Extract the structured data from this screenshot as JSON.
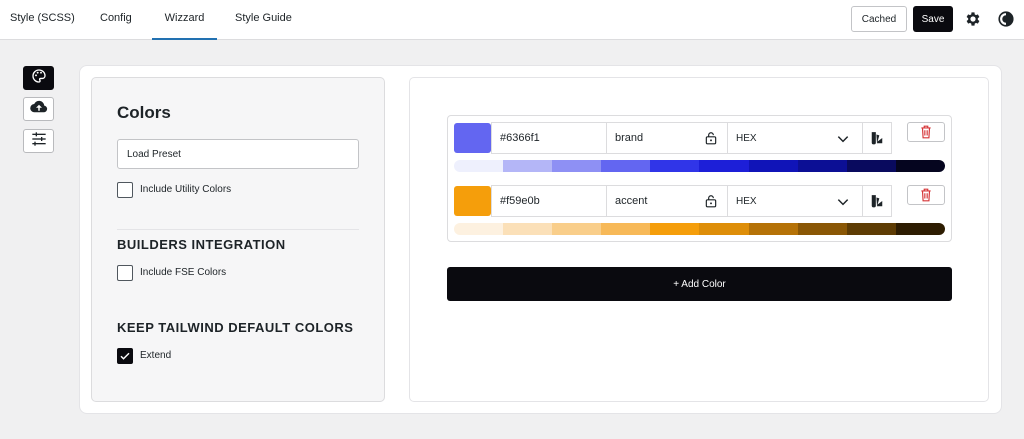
{
  "nav": {
    "tabs": [
      {
        "label": "Style (SCSS)"
      },
      {
        "label": "Config"
      },
      {
        "label": "Wizzard"
      },
      {
        "label": "Style Guide"
      }
    ],
    "active_tab": "Wizzard",
    "cached_label": "Cached",
    "save_label": "Save",
    "accent": "#2271b1",
    "icons": [
      "gear-icon",
      "contrast-icon"
    ]
  },
  "rail": {
    "items": [
      {
        "icon": "palette-icon",
        "active": true
      },
      {
        "icon": "cloud-upload-icon",
        "active": false
      },
      {
        "icon": "sliders-icon",
        "active": false
      }
    ]
  },
  "settings": {
    "title": "Colors",
    "preset_placeholder": "Load Preset",
    "utility_label": "Include Utility Colors",
    "utility_checked": false,
    "builders_heading": "BUILDERS INTEGRATION",
    "fse_label": "Include FSE Colors",
    "fse_checked": false,
    "keep_heading": "KEEP TAILWIND DEFAULT COLORS",
    "extend_label": "Extend",
    "extend_checked": true
  },
  "colors": [
    {
      "hex": "#6366f1",
      "name": "brand",
      "format": "HEX",
      "locked": false,
      "shades": [
        "#eef0fd",
        "#b4b6f7",
        "#8e90f4",
        "#6366f1",
        "#3035e8",
        "#1d1fd8",
        "#1014b8",
        "#0c0f95",
        "#090a5e",
        "#05051f"
      ]
    },
    {
      "hex": "#f59e0b",
      "name": "accent",
      "format": "HEX",
      "locked": false,
      "shades": [
        "#fdf1e0",
        "#fbe0b8",
        "#f9ce8a",
        "#f7b958",
        "#f59e0b",
        "#de8e09",
        "#b57207",
        "#8a5705",
        "#5e3c04",
        "#2e1d02"
      ]
    }
  ],
  "add_color_label": "+ Add Color"
}
